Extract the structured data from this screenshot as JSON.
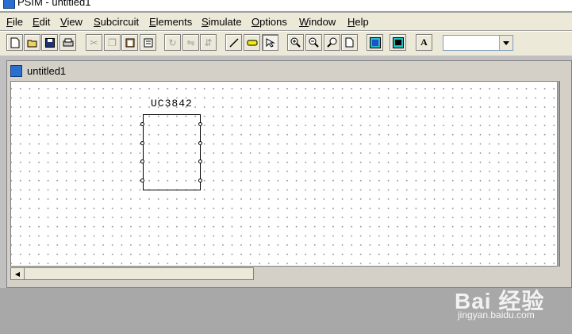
{
  "window": {
    "title": "PSIM - untitled1"
  },
  "menu": [
    {
      "label": "File",
      "ul": "F",
      "rest": "ile"
    },
    {
      "label": "Edit",
      "ul": "E",
      "rest": "dit"
    },
    {
      "label": "View",
      "ul": "V",
      "rest": "iew"
    },
    {
      "label": "Subcircuit",
      "ul": "S",
      "rest": "ubcircuit"
    },
    {
      "label": "Elements",
      "ul": "E",
      "rest": "lements"
    },
    {
      "label": "Simulate",
      "ul": "S",
      "rest": "imulate"
    },
    {
      "label": "Options",
      "ul": "O",
      "rest": "ptions"
    },
    {
      "label": "Window",
      "ul": "W",
      "rest": "indow"
    },
    {
      "label": "Help",
      "ul": "H",
      "rest": "elp"
    }
  ],
  "toolbar": {
    "text_tool_label": "A",
    "combo_value": ""
  },
  "document": {
    "title": "untitled1"
  },
  "component": {
    "label": "UC3842"
  },
  "watermark": {
    "brand": "Bai 经验",
    "site": "jingyan.baidu.com"
  },
  "colors": {
    "canvas_bg": "#ffffff",
    "chrome_bg": "#ece9d8",
    "mdi_bg": "#c0c0c0",
    "grid_dot": "#8c8c8c"
  }
}
